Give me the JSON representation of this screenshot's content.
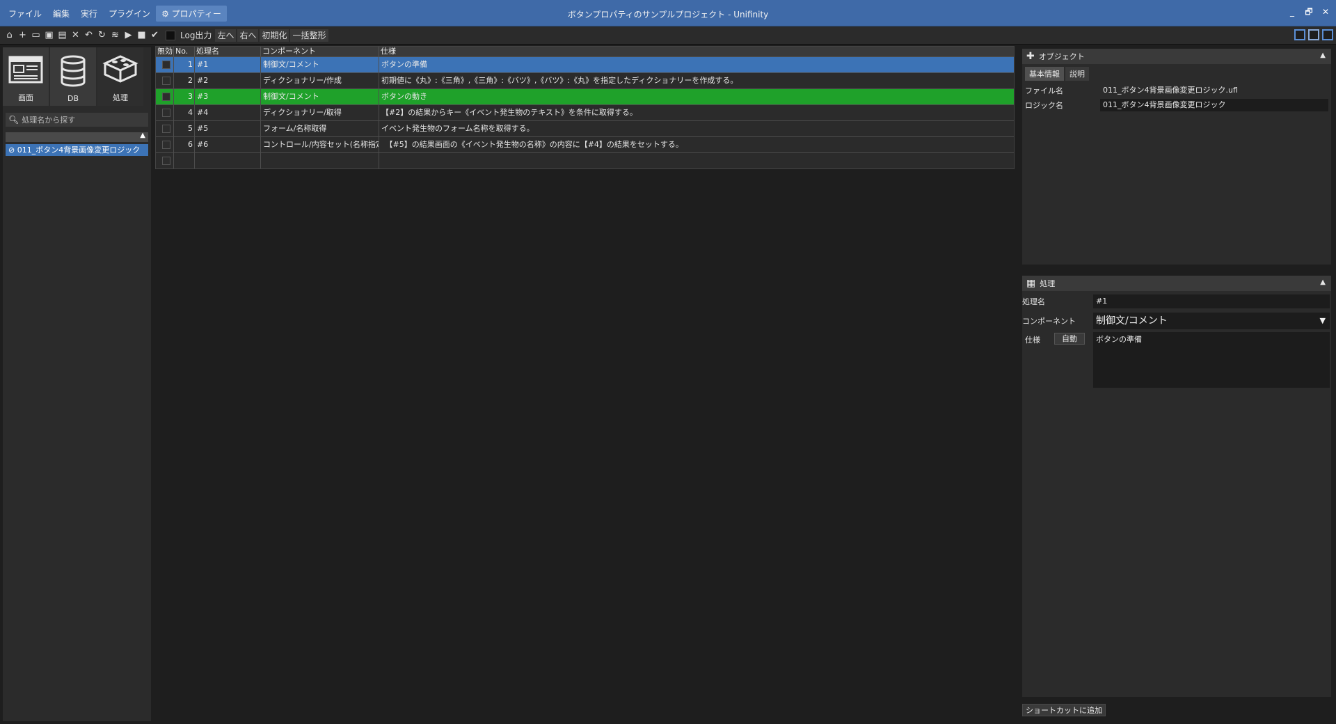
{
  "window": {
    "title": "ボタンプロパティのサンプルプロジェクト - Unifinity",
    "controls": [
      "_",
      "🗗",
      "✕"
    ]
  },
  "menu": {
    "items": [
      "ファイル",
      "編集",
      "実行",
      "プラグイン",
      "プロパティー"
    ]
  },
  "toolbar": {
    "log_label": "Log出力",
    "left_label": "左へ",
    "right_label": "右へ",
    "init_label": "初期化",
    "format_label": "一括整形"
  },
  "left_panel": {
    "tiles": [
      {
        "label": "画面",
        "icon": "screen-icon"
      },
      {
        "label": "DB",
        "icon": "database-icon"
      },
      {
        "label": "処理",
        "icon": "process-icon"
      }
    ],
    "search_placeholder": "処理名から探す",
    "tree_item": "011_ボタン4背景画像変更ロジック"
  },
  "grid": {
    "headers": [
      "無効",
      "No.",
      "処理名",
      "コンポーネント",
      "仕様"
    ],
    "rows": [
      {
        "no": "1",
        "name": "#1",
        "component": "制御文/コメント",
        "spec": "ボタンの準備",
        "state": "selected"
      },
      {
        "no": "2",
        "name": "#2",
        "component": "ディクショナリー/作成",
        "spec": "初期値に《丸》:《三角》,《三角》:《バツ》,《バツ》:《丸》を指定したディクショナリーを作成する。",
        "state": "normal"
      },
      {
        "no": "3",
        "name": "#3",
        "component": "制御文/コメント",
        "spec": "ボタンの動き",
        "state": "highlight"
      },
      {
        "no": "4",
        "name": "#4",
        "component": "ディクショナリー/取得",
        "spec": "【#2】の結果からキー《イベント発生物のテキスト》を条件に取得する。",
        "state": "normal"
      },
      {
        "no": "5",
        "name": "#5",
        "component": "フォーム/名称取得",
        "spec": "イベント発生物のフォーム名称を取得する。",
        "state": "normal"
      },
      {
        "no": "6",
        "name": "#6",
        "component": "コントロール/内容セット(名称指定)",
        "spec": "　【#5】の結果画面の《イベント発生物の名称》の内容に【#4】の結果をセットする。",
        "state": "normal"
      },
      {
        "no": "",
        "name": "",
        "component": "",
        "spec": "",
        "state": "normal"
      }
    ]
  },
  "object_panel": {
    "title": "オブジェクト",
    "tabs": [
      "基本情報",
      "説明"
    ],
    "file_label": "ファイル名",
    "file_value": "011_ボタン4背景画像変更ロジック.ufl",
    "logic_label": "ロジック名",
    "logic_value": "011_ボタン4背景画像変更ロジック"
  },
  "process_panel": {
    "title": "処理",
    "name_label": "処理名",
    "name_value": "#1",
    "component_label": "コンポーネント",
    "component_value": "制御文/コメント",
    "spec_label": "仕様",
    "auto_button": "自動",
    "spec_value": "ボタンの準備"
  },
  "footer": {
    "shortcut_button": "ショートカットに追加"
  },
  "colors": {
    "title_bar": "#3f6aa8",
    "selected_row": "#3c73b6",
    "highlight_row": "#1fa12a"
  }
}
